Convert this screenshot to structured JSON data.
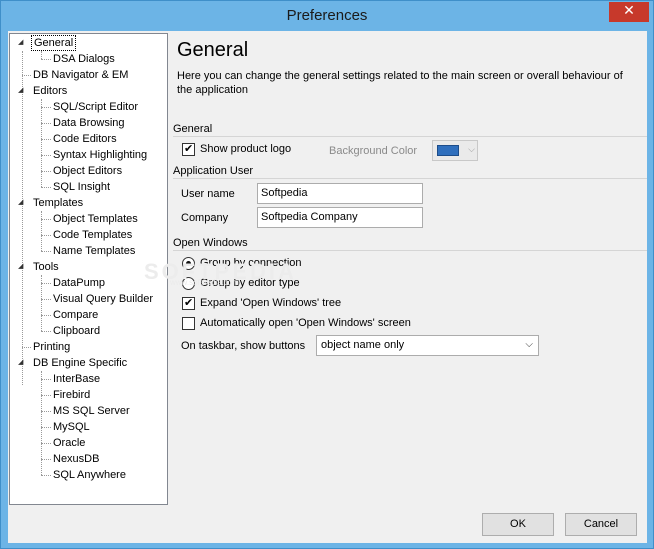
{
  "window": {
    "title": "Preferences",
    "close_glyph": "✕"
  },
  "tree": {
    "items": [
      {
        "label": "General",
        "level": 0,
        "expanded": true,
        "selected": true
      },
      {
        "label": "DSA Dialogs",
        "level": 1
      },
      {
        "label": "DB Navigator & EM",
        "level": 0
      },
      {
        "label": "Editors",
        "level": 0,
        "expanded": true
      },
      {
        "label": "SQL/Script Editor",
        "level": 1
      },
      {
        "label": "Data Browsing",
        "level": 1
      },
      {
        "label": "Code Editors",
        "level": 1
      },
      {
        "label": "Syntax Highlighting",
        "level": 1
      },
      {
        "label": "Object Editors",
        "level": 1
      },
      {
        "label": "SQL Insight",
        "level": 1
      },
      {
        "label": "Templates",
        "level": 0,
        "expanded": true
      },
      {
        "label": "Object Templates",
        "level": 1
      },
      {
        "label": "Code Templates",
        "level": 1
      },
      {
        "label": "Name Templates",
        "level": 1
      },
      {
        "label": "Tools",
        "level": 0,
        "expanded": true
      },
      {
        "label": "DataPump",
        "level": 1
      },
      {
        "label": "Visual Query Builder",
        "level": 1
      },
      {
        "label": "Compare",
        "level": 1
      },
      {
        "label": "Clipboard",
        "level": 1
      },
      {
        "label": "Printing",
        "level": 0
      },
      {
        "label": "DB Engine Specific",
        "level": 0,
        "expanded": true
      },
      {
        "label": "InterBase",
        "level": 1
      },
      {
        "label": "Firebird",
        "level": 1
      },
      {
        "label": "MS SQL Server",
        "level": 1
      },
      {
        "label": "MySQL",
        "level": 1
      },
      {
        "label": "Oracle",
        "level": 1
      },
      {
        "label": "NexusDB",
        "level": 1
      },
      {
        "label": "SQL Anywhere",
        "level": 1
      }
    ]
  },
  "panel": {
    "title": "General",
    "description": "Here you can change the general settings related to the main screen or overall behaviour of the application",
    "general": {
      "section": "General",
      "show_logo_label": "Show product logo",
      "show_logo_checked": true,
      "background_color_label": "Background Color",
      "background_color": "#2f6fbd"
    },
    "app_user": {
      "section": "Application User",
      "user_name_label": "User name",
      "user_name_value": "Softpedia",
      "company_label": "Company",
      "company_value": "Softpedia Company"
    },
    "open_windows": {
      "section": "Open Windows",
      "group_by_connection": "Group by connection",
      "group_by_editor_type": "Group by editor type",
      "group_selected": "connection",
      "expand_tree_label": "Expand 'Open Windows' tree",
      "expand_tree_checked": true,
      "auto_open_label": "Automatically open 'Open Windows' screen",
      "auto_open_checked": false,
      "taskbar_label": "On taskbar, show buttons",
      "taskbar_value": "object name only"
    }
  },
  "buttons": {
    "ok": "OK",
    "cancel": "Cancel"
  },
  "watermark": {
    "text": "SOFTPEDIA",
    "sub": "www.softpedia.com"
  },
  "icons": {
    "expanded": "◢",
    "checkmark": "✔",
    "dropdown": "▼",
    "close": "close-icon"
  }
}
